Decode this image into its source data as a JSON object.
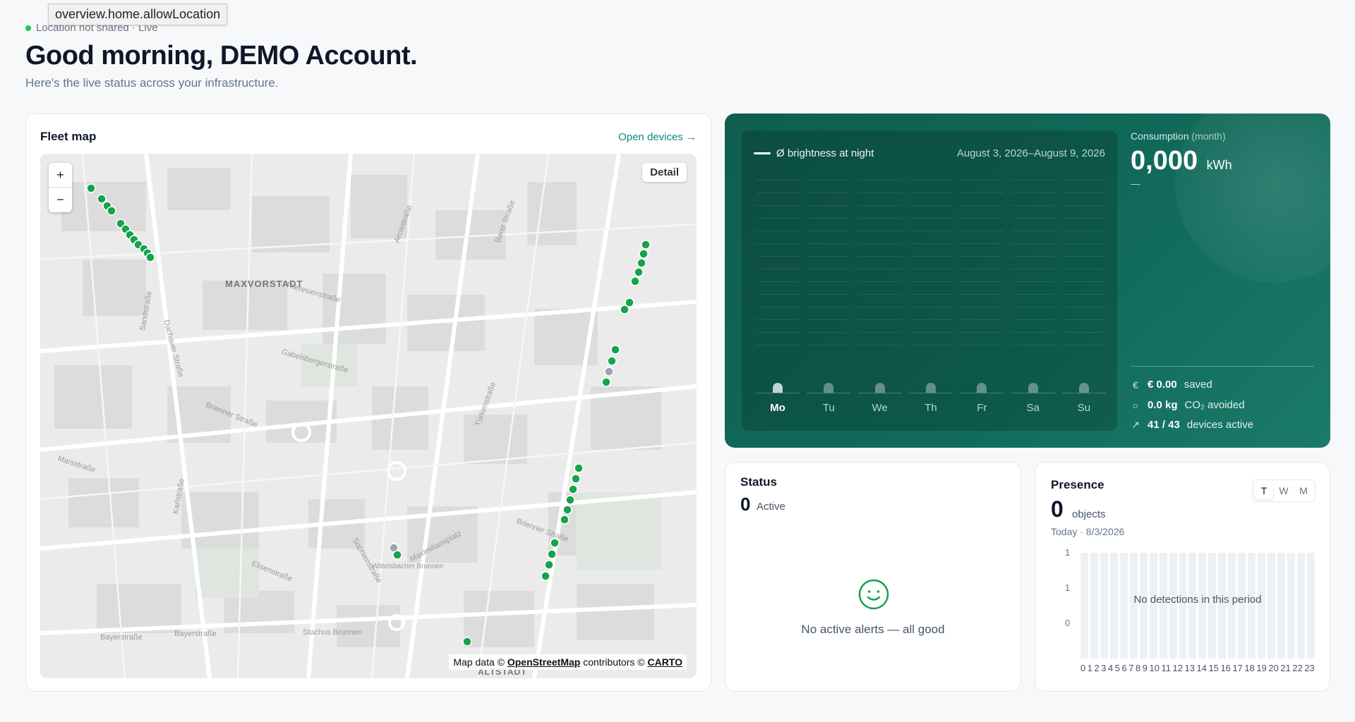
{
  "tooltip": "overview.home.allowLocation",
  "header": {
    "location_status": "Location not shared · Live",
    "greeting": "Good morning, DEMO Account.",
    "subtitle": "Here's the live status across your infrastructure."
  },
  "fleet_map": {
    "title": "Fleet map",
    "open_devices": "Open devices →",
    "zoom_in": "+",
    "zoom_out": "−",
    "detail": "Detail",
    "attribution_prefix": "Map data ©",
    "attribution_osm": "OpenStreetMap",
    "attribution_mid": "contributors ©",
    "attribution_carto": "CARTO",
    "district_labels": [
      "MAXVORSTADT",
      "ALTSTADT"
    ],
    "street_labels": [
      "Theresienstraße",
      "Gabelsbergerstraße",
      "Brienner Straße",
      "Arcisstraße",
      "Barer Straße",
      "Türkenstraße",
      "Maximiliansplatz",
      "Brienner Straße",
      "Elisenstraße",
      "Sophienstraße",
      "Bayerstraße",
      "Bayerstraße",
      "Stachus Brunnen",
      "Marsstraße",
      "Dachauer Straße",
      "Karlstraße",
      "Sandstraße",
      "Wittelsbacher Brunnen"
    ],
    "device_colors": {
      "online": "#16a34a",
      "offline": "#9ca3af"
    }
  },
  "brightness": {
    "legend": "Ø brightness at night",
    "date_range": "August 3, 2026–August 9, 2026",
    "days": [
      "Mo",
      "Tu",
      "We",
      "Th",
      "Fr",
      "Sa",
      "Su"
    ],
    "active_day": "Mo"
  },
  "consumption": {
    "label": "Consumption",
    "period": "(month)",
    "value": "0,000",
    "unit": "kWh",
    "delta": "—",
    "saved_symbol": "€",
    "saved_value": "€ 0.00",
    "saved_label": "saved",
    "co2_symbol": "○",
    "co2_value": "0.0 kg",
    "co2_label": "CO₂ avoided",
    "devices_symbol": "↗",
    "devices_value": "41 / 43",
    "devices_label": "devices active"
  },
  "status": {
    "title": "Status",
    "count": "0",
    "count_label": "Active",
    "empty_message": "No active alerts — all good"
  },
  "presence": {
    "title": "Presence",
    "ranges": [
      "T",
      "W",
      "M"
    ],
    "active_range": "T",
    "count": "0",
    "count_label": "objects",
    "date": "Today · 8/3/2026",
    "y_labels": [
      "1",
      "1",
      "0"
    ],
    "empty_message": "No detections in this period",
    "hours": [
      "0",
      "1",
      "2",
      "3",
      "4",
      "5",
      "6",
      "7",
      "8",
      "9",
      "10",
      "11",
      "12",
      "13",
      "14",
      "15",
      "16",
      "17",
      "18",
      "19",
      "20",
      "21",
      "22",
      "23"
    ]
  },
  "colors": {
    "accent": "#0f8a80",
    "card_green": "#116a5b"
  }
}
